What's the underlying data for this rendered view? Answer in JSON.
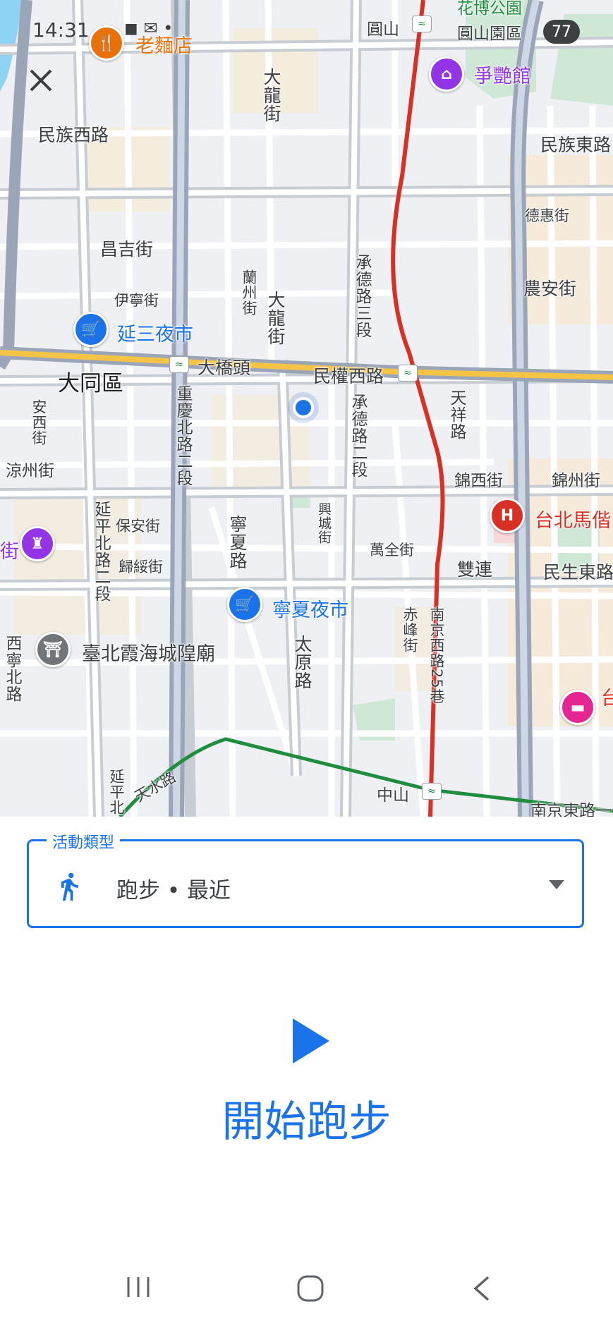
{
  "status_bar": {
    "time": "14:31",
    "battery": "77"
  },
  "map": {
    "district": "大同區",
    "road_labels": {
      "minzu_w": "民族西路",
      "minzu_e": "民族東路",
      "changji": "昌吉街",
      "yining": "伊寧街",
      "lanzhou": "蘭州街",
      "dalong_top": "大龍街",
      "dalong_mid": "大龍街",
      "chengde3": "承德路三段",
      "chengde2": "承德路二段",
      "minquan_w": "民權西路",
      "daqiaotou": "大橋頭",
      "dehui": "德惠街",
      "nongan": "農安街",
      "tianxiang": "天祥路",
      "jinxi": "錦西街",
      "jinzhou": "錦州街",
      "minsheng_e": "民生東路",
      "shuanglian": "雙連",
      "chongqing_n2": "重慶北路二段",
      "anxi": "安西街",
      "liangzhou": "涼州街",
      "yanping_n2": "延平北路二段",
      "baoan": "保安街",
      "guisui": "歸綏街",
      "ningxia_rd": "寧夏路",
      "xingcheng": "興城街",
      "wanquan": "萬全街",
      "chifeng": "赤峰街",
      "nanjing_w25": "南京西路25巷",
      "taiyuan": "太原路",
      "xixining_n": "西寧北路",
      "yanping_bottom": "延平北",
      "tianshui": "天水路",
      "zhongshan": "中山",
      "nanjing_e": "南京東路一",
      "yuanshan": "圓山",
      "expo_park": "花博公園",
      "expo_area": "圓山園區"
    },
    "pois": {
      "noodle": "老麵店",
      "zhengyan": "爭艷館",
      "yansan": "延三夜市",
      "ningxia": "寧夏夜市",
      "xiahai": "臺北霞海城隍廟",
      "mackay": "台北馬偕",
      "left_edge": "街",
      "right_edge": "台"
    }
  },
  "activity": {
    "legend": "活動類型",
    "value": "跑步 • 最近"
  },
  "start_button": {
    "label": "開始跑步"
  },
  "colors": {
    "accent": "#1a73e8",
    "rail_red": "#d93025",
    "rail_green": "#1e8e3e",
    "highway_yellow": "#f6c445"
  }
}
